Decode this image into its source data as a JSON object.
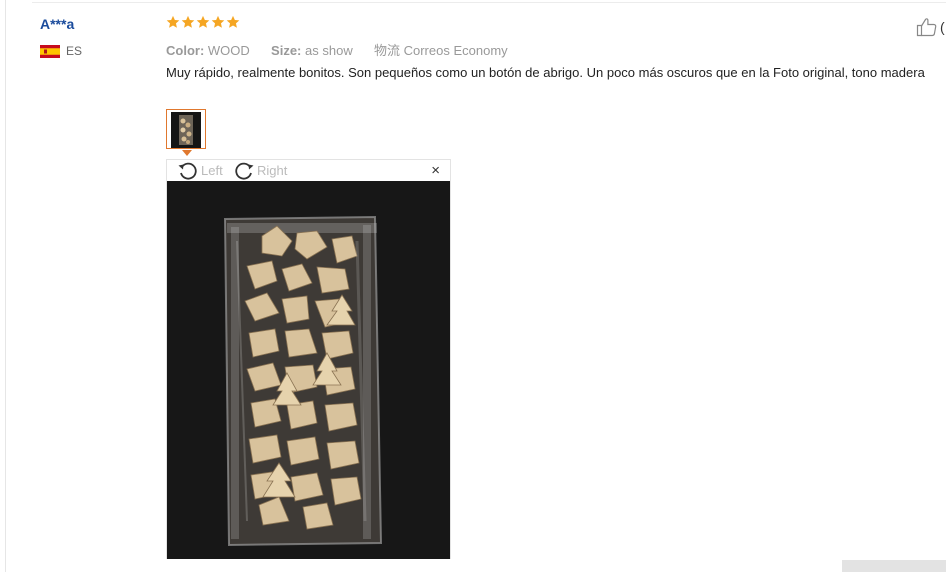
{
  "review": {
    "user_name": "A***a",
    "country_code": "ES",
    "rating": 5,
    "color_label": "Color:",
    "color_value": "WOOD",
    "size_label": "Size:",
    "size_value": "as show",
    "shipping_label": "物流",
    "shipping_value": "Correos Economy",
    "text": "Muy rápido, realmente bonitos. Son pequeños como un botón de abrigo. Un poco más oscuros que en la Foto original, tono madera",
    "helpful_count": "("
  },
  "viewer": {
    "rotate_left_label": "Left",
    "rotate_right_label": "Right",
    "close_label": "×"
  },
  "colors": {
    "username": "#1a4b9c",
    "star": "#f5a623",
    "thumb_border": "#e0782e"
  }
}
